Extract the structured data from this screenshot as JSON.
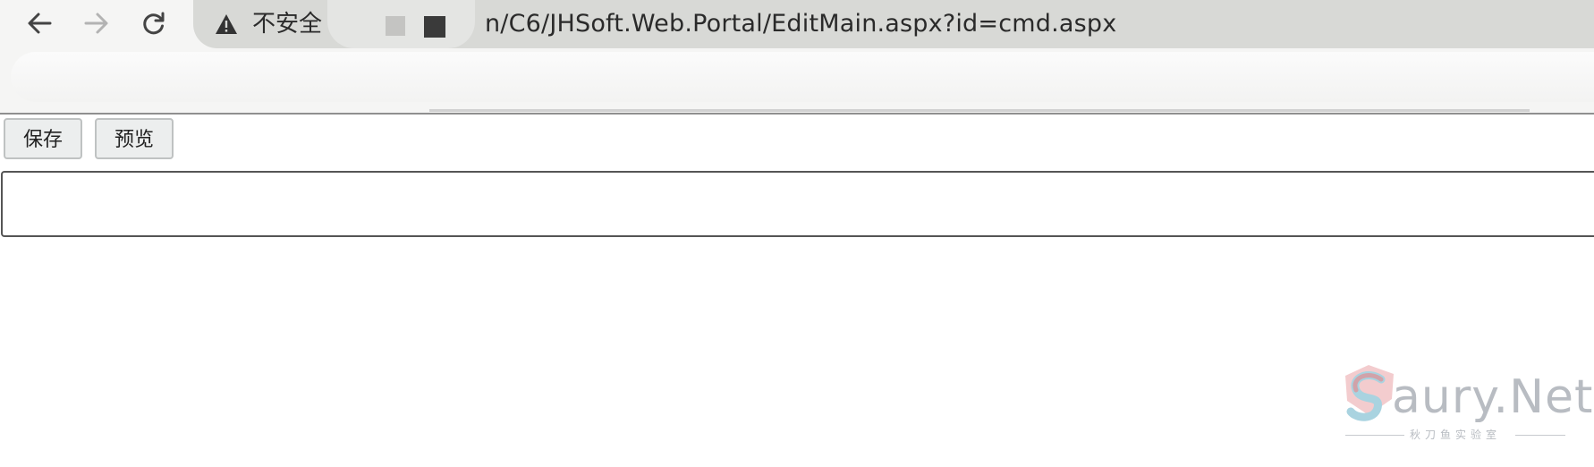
{
  "browser": {
    "security_label": "不安全",
    "url": "n/C6/JHSoft.Web.Portal/EditMain.aspx?id=cmd.aspx",
    "icons": {
      "back": "arrow-left-icon",
      "forward": "arrow-right-icon",
      "reload": "reload-icon",
      "security": "warning-triangle-icon"
    }
  },
  "page": {
    "buttons": {
      "save_label": "保存",
      "preview_label": "预览"
    },
    "editor_value": ""
  },
  "watermark": {
    "text": "aury.Net",
    "subtitle": "秋刀鱼实验室"
  },
  "colors": {
    "omnibox_bg": "#d8d9d6",
    "toolbar_bg": "#f5f5f4",
    "button_bg": "#eceeee",
    "watermark": "#b8bcc2"
  }
}
